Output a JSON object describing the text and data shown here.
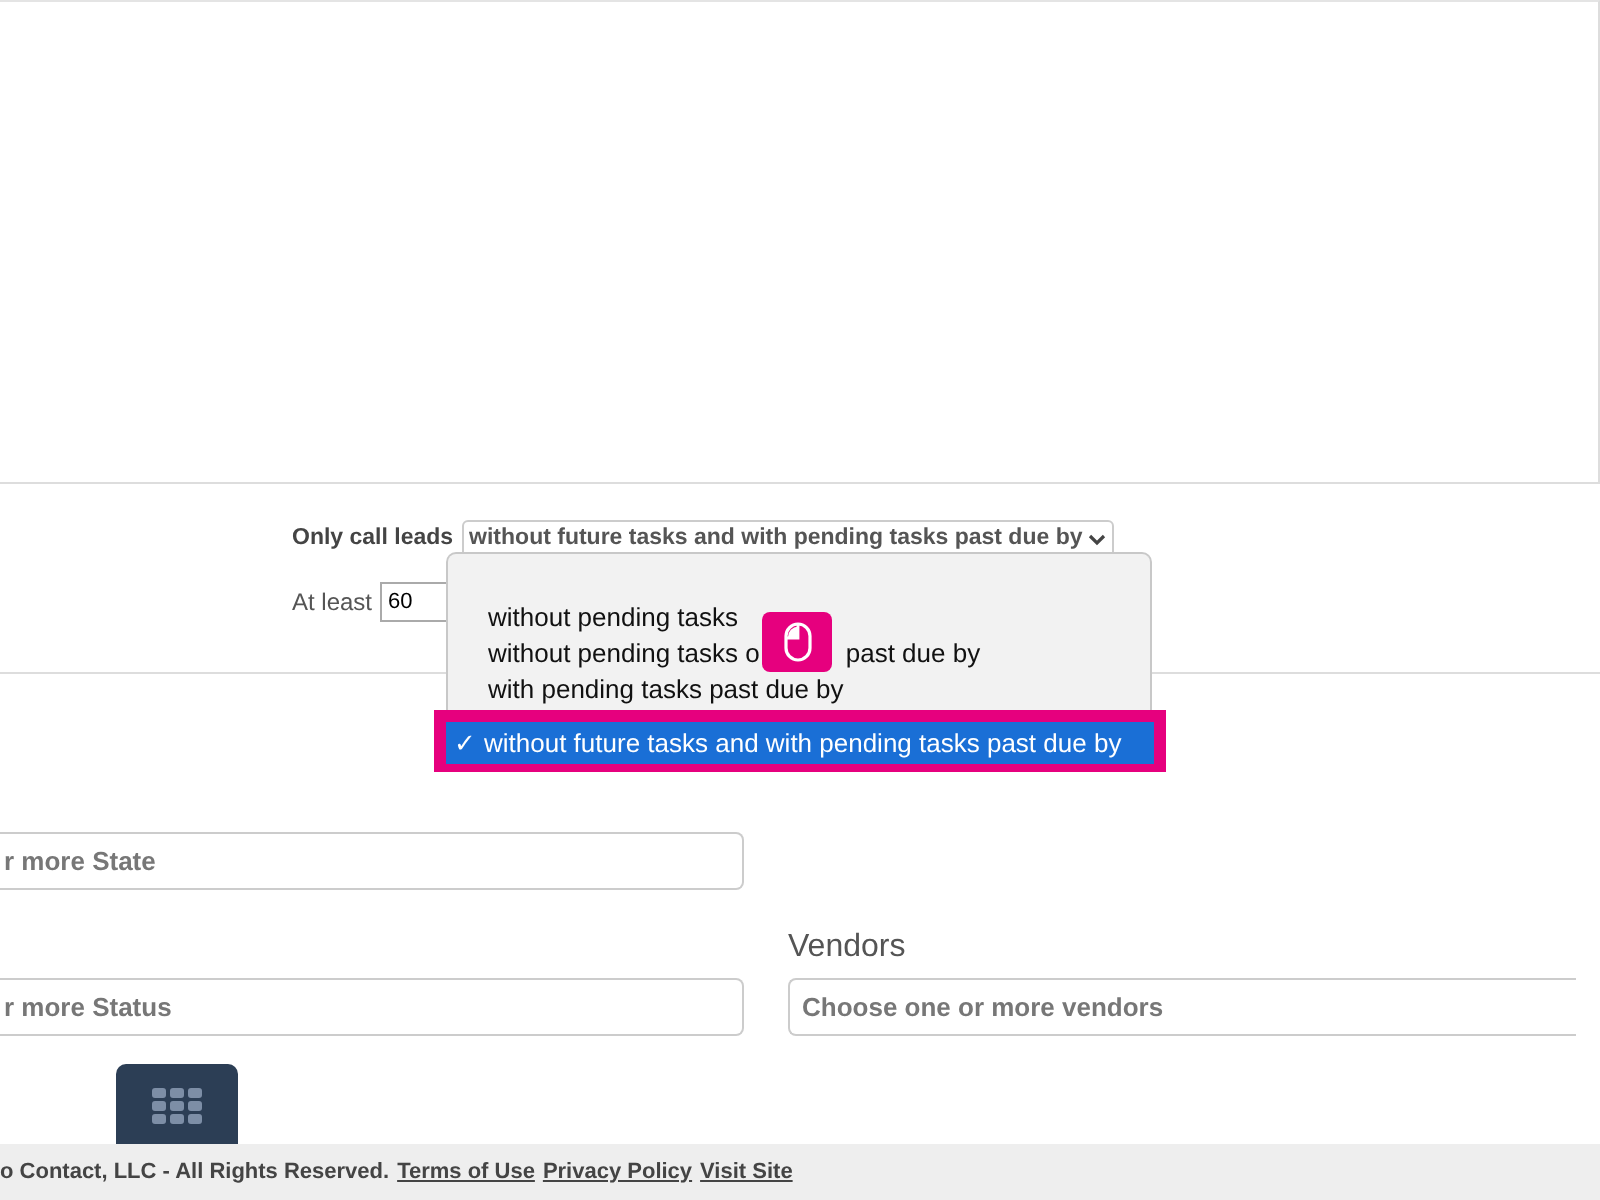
{
  "filter": {
    "label": "Only call leads",
    "value": "without future tasks and with pending tasks past due by",
    "at_least_label": "At least",
    "at_least_value": "60"
  },
  "dropdown": {
    "options": [
      {
        "kind": "blank",
        "selected": false
      },
      {
        "kind": "plain",
        "text": "without pending tasks",
        "selected": false
      },
      {
        "kind": "covered",
        "text": "without pending tasks o",
        "text_after": "past due by",
        "selected": false
      },
      {
        "kind": "plain",
        "text": "with pending tasks past due by",
        "selected": false
      },
      {
        "kind": "checkable",
        "text": "without future tasks and with pending tasks past due by",
        "selected": true,
        "check": "✓"
      }
    ]
  },
  "fields": [
    {
      "placeholder": "r more State"
    },
    {
      "placeholder": "r more Status"
    },
    {
      "label": "Vendors",
      "placeholder": "Choose one or more vendors"
    }
  ],
  "footer": {
    "text": "o Contact, LLC - All Rights Reserved.",
    "links": [
      "Terms of Use",
      "Privacy Policy",
      "Visit Site"
    ]
  }
}
